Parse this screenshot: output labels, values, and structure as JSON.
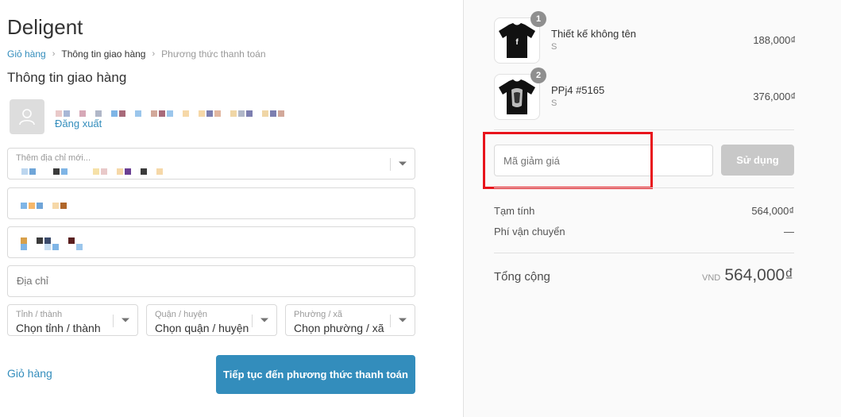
{
  "store": {
    "name": "Deligent"
  },
  "breadcrumb": {
    "cart": "Giỏ hàng",
    "shipping_info": "Thông tin giao hàng",
    "payment_method": "Phương thức thanh toán"
  },
  "section_title": "Thông tin giao hàng",
  "account": {
    "logout_label": "Đăng xuất"
  },
  "form": {
    "address_select_label": "Thêm địa chỉ mới...",
    "address_placeholder": "Địa chỉ",
    "province_label": "Tỉnh / thành",
    "province_value": "Chọn tỉnh / thành",
    "district_label": "Quận / huyện",
    "district_value": "Chọn quận / huyện",
    "ward_label": "Phường / xã",
    "ward_value": "Chọn phường / xã"
  },
  "actions": {
    "back_to_cart": "Giỏ hàng",
    "continue": "Tiếp tục đến phương thức thanh toán"
  },
  "cart": {
    "items": [
      {
        "name": "Thiết kế không tên",
        "variant": "S",
        "quantity": "1",
        "price": "188,000₫"
      },
      {
        "name": "PPj4 #5165",
        "variant": "S",
        "quantity": "2",
        "price": "376,000₫"
      }
    ]
  },
  "discount": {
    "placeholder": "Mã giảm giá",
    "apply_label": "Sử dụng"
  },
  "summary": {
    "subtotal_label": "Tạm tính",
    "subtotal_value": "564,000₫",
    "shipping_label": "Phí vận chuyển",
    "shipping_value": "—",
    "total_label": "Tổng cộng",
    "currency": "VND",
    "total_value": "564,000₫"
  },
  "colors": {
    "accent": "#338dbc",
    "highlight": "#e8141c",
    "button_disabled": "#c8c8c8"
  }
}
